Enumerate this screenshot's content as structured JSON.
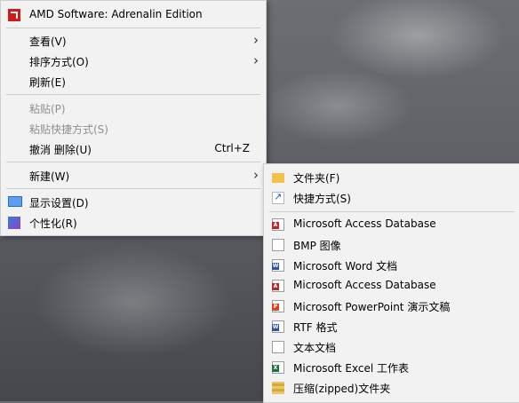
{
  "main_menu": {
    "items": [
      {
        "label": "AMD Software: Adrenalin Edition",
        "icon": "amd-logo-icon"
      },
      {
        "label": "查看(V)"
      },
      {
        "label": "排序方式(O)"
      },
      {
        "label": "刷新(E)"
      },
      {
        "label": "粘贴(P)"
      },
      {
        "label": "粘贴快捷方式(S)"
      },
      {
        "label": "撤消 删除(U)",
        "shortcut": "Ctrl+Z"
      },
      {
        "label": "新建(W)"
      },
      {
        "label": "显示设置(D)",
        "icon": "monitor-icon"
      },
      {
        "label": "个性化(R)",
        "icon": "personalize-icon"
      }
    ]
  },
  "new_submenu": {
    "items": [
      {
        "label": "文件夹(F)",
        "icon": "folder-icon"
      },
      {
        "label": "快捷方式(S)",
        "icon": "shortcut-icon"
      },
      {
        "label": "Microsoft Access Database",
        "icon": "access-icon"
      },
      {
        "label": "BMP 图像",
        "icon": "bmp-image-icon"
      },
      {
        "label": "Microsoft Word 文档",
        "icon": "word-icon"
      },
      {
        "label": "Microsoft Access Database",
        "icon": "access-icon"
      },
      {
        "label": "Microsoft PowerPoint 演示文稿",
        "icon": "powerpoint-icon"
      },
      {
        "label": "RTF 格式",
        "icon": "rtf-icon"
      },
      {
        "label": "文本文档",
        "icon": "text-document-icon"
      },
      {
        "label": "Microsoft Excel 工作表",
        "icon": "excel-icon"
      },
      {
        "label": "压缩(zipped)文件夹",
        "icon": "zip-folder-icon"
      }
    ]
  },
  "colors": {
    "menu_bg": "#f2f2f2",
    "disabled_text": "#8f8f8f",
    "amd_red": "#d11a1a",
    "folder_yellow": "#f3c24c"
  }
}
